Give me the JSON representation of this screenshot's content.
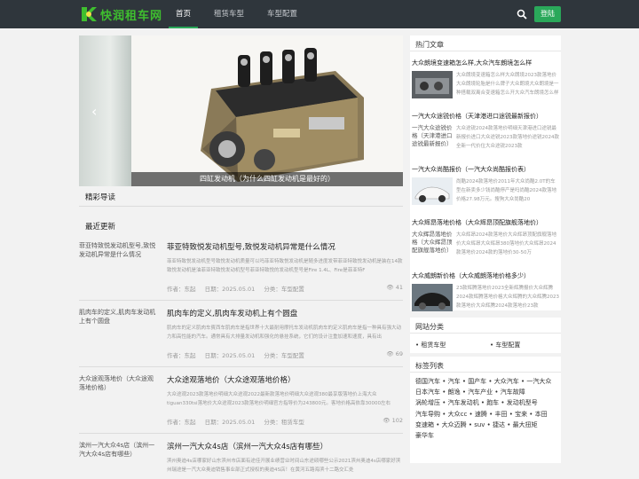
{
  "header": {
    "logo_text": "快润租车网",
    "nav": [
      "首页",
      "租赁车型",
      "车型配置"
    ],
    "login_label": "登陆"
  },
  "slider": {
    "caption": "四缸发动机（为什么四缸发动机是最好的）"
  },
  "sections": {
    "featured": "精彩导读",
    "latest": "最近更新"
  },
  "articles": [
    {
      "thumb_alt": "菲亚特致悦发动机型号,致悦发动机异常是什么情况",
      "title": "菲亚特致悦发动机型号,致悦发动机异常是什么情况",
      "excerpt": "菲亚特致悦发动机型号致悦发动机质量可以吗菲亚特致悦发动机是随多进度发带菲亚特致悦发动机是装在14款致悦发动机是油菲亚特致悦发动机型号菲亚特致悦的发动机型号是Fire 1.4L、Fire是菲亚特F",
      "author": "作者：东起",
      "date": "日期：2025.05.01",
      "category": "分类：车型配置",
      "views": "41"
    },
    {
      "thumb_alt": "肌肉车的定义,肌肉车发动机上有个圆盘",
      "title": "肌肉车的定义,肌肉车发动机上有个圆盘",
      "excerpt": "肌肉车的定义肌肉车賓西车肌肉车是指世界十大最耐用摩托车发动机肌肉车的定义肌肉车是指一种具有强大动力和高性能的汽车。通常具有大排量发动机和强化的悬挂系统，它们的设计注重加速和速度，具有出",
      "author": "作者：东起",
      "date": "日期：2025.05.01",
      "category": "分类：车型配置",
      "views": "69"
    },
    {
      "thumb_alt": "大众途观落地价（大众途观落地价格）",
      "title": "大众途观落地价（大众途观落地价格）",
      "excerpt": "大众途观2023款落地价明细大众途观2022最新款落地价明细大众途观380最享版落地价上海大众tiguan330tsi落地价大众途观2023款落地价明细官方指导价为243800元。客地价格高依靠30000左右",
      "author": "作者：东起",
      "date": "日期：2025.05.01",
      "category": "分类：租赁车型",
      "views": "102"
    },
    {
      "thumb_alt": "滨州一汽大众4s店（滨州一汽大众4s店有哪些）",
      "title": "滨州一汽大众4s店（滨州一汽大众4s店有哪些）",
      "excerpt": "滨州奥迪4s店哪家好山东滨州市店面有途佳开展业绩营业时间山东途硕哪些公示2021滨州奥迪4s店哪家好滨州瑞途是一汽大众奥迪销售事业部正式授权的奥迪4S店！在黄河五路海滨十二路交汇处",
      "author": "",
      "date": "",
      "category": "",
      "views": ""
    }
  ],
  "sidebar": {
    "hot_title": "热门文章",
    "hot": [
      {
        "title": "大众朗境变速箱怎么样,大众汽车朗境怎么样",
        "thumb_alt": "",
        "excerpt": "大众朗境变速箱怎么样大众朗境2023款落地价大众朗境轮胎是什么牌子大众朗境大众朗境是一种搭载双离合变速箱怎么开大众汽车朗境怎么样"
      },
      {
        "title": "一汽大众途锐价格（天津港进口途锐最新报价）",
        "thumb_alt": "一汽大众途锐价格（天津港进口途锐最新报价）",
        "excerpt": "大众途锐2024款落地价明细天津港进口途锐最新报价进口大众途锐2023款落地价途锐2024款全新一代价位大众途锐2023款"
      },
      {
        "title": "一汽大众尚酷报价（一汽大众尚酷报价表）",
        "thumb_alt": "",
        "excerpt": "尚酷2024款落地价2011年大众尚酷2.0T的车型在新卖多少钱尚酷停产是吗尚酷2024款落地价格27.98万元。搜狗大众尚酷20"
      },
      {
        "title": "大众辉昂落地价格（大众辉昂顶配旗舰落地价）",
        "thumb_alt": "大众辉昂落地价格（大众辉昂顶配旗舰落地价）",
        "excerpt": "大众辉昂2024款落地价大众辉昂顶配旗舰落地价大众辉昂大众辉昂380落地价大众辉昂2024款落地价2024款的落地价30-50万"
      },
      {
        "title": "大众威朗新价格（大众威朗落地价格多少）",
        "thumb_alt": "",
        "excerpt": "23款辉腾落地价2023全新辉腾报价大众辉腾2024款辉腾落地价格大众辉腾的大众辉腾2023款落地价大众辉腾2024款落地价23款"
      }
    ],
    "site_cat_title": "网站分类",
    "site_cats": [
      "租赁车型",
      "车型配置"
    ],
    "tags_title": "标签列表",
    "tags": [
      "德国汽车",
      "汽车",
      "国产车",
      "大众汽车",
      "一汽大众",
      "日本汽车",
      "朗逸",
      "汽车产业",
      "汽车故障",
      "涡轮增压",
      "汽车发动机",
      "跑车",
      "发动机型号",
      "汽车导购",
      "大众cc",
      "速腾",
      "丰田",
      "宝来",
      "本田",
      "变速箱",
      "大众迈腾",
      "suv",
      "捷达",
      "最大扭矩",
      "豪华车"
    ]
  }
}
